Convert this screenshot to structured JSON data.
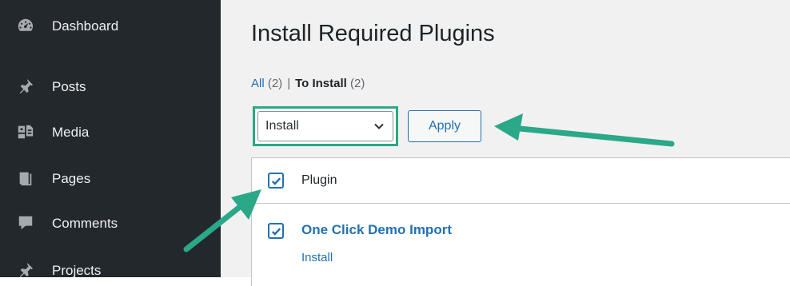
{
  "sidebar": {
    "items": [
      {
        "label": "Dashboard",
        "icon": "dashboard-icon"
      },
      {
        "label": "Posts",
        "icon": "pushpin-icon"
      },
      {
        "label": "Media",
        "icon": "media-icon"
      },
      {
        "label": "Pages",
        "icon": "pages-icon"
      },
      {
        "label": "Comments",
        "icon": "comment-icon"
      },
      {
        "label": "Projects",
        "icon": "pushpin-icon"
      }
    ]
  },
  "main": {
    "title": "Install Required Plugins",
    "filters": {
      "all_label": "All",
      "all_count": "(2)",
      "separator": "|",
      "to_install_label": "To Install",
      "to_install_count": "(2)"
    },
    "bulk_action": {
      "selected": "Install",
      "apply_label": "Apply"
    },
    "table": {
      "header_label": "Plugin",
      "rows": [
        {
          "name": "One Click Demo Import",
          "action": "Install"
        }
      ]
    }
  },
  "colors": {
    "sidebar_bg": "#23282d",
    "highlight": "#2aa888",
    "link": "#2271b1"
  }
}
